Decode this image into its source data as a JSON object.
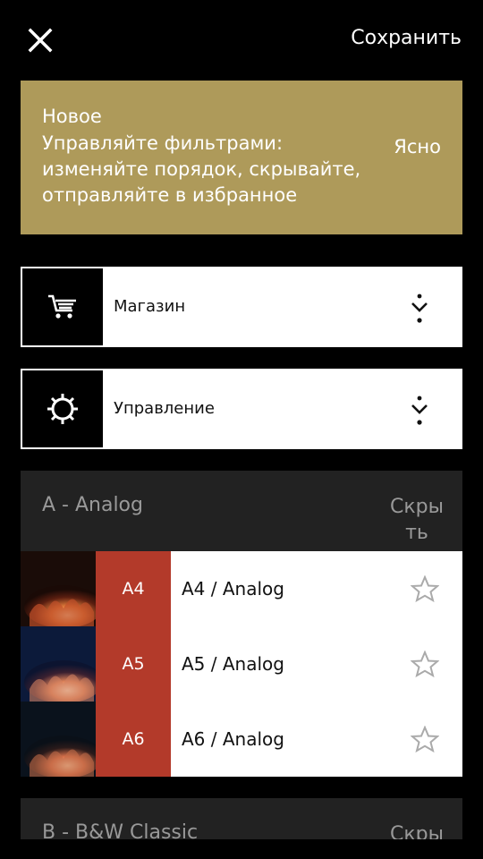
{
  "toolbar": {
    "close_icon": "close-icon",
    "save_label": "Сохранить"
  },
  "banner": {
    "title": "Новое",
    "text": "Управляйте фильтрами: изменяйте порядок, скрывайте, отправляйте в избранное",
    "ok_label": "Ясно",
    "background": "#ae9a5a"
  },
  "menu": [
    {
      "label": "Магазин",
      "icon": "shopping-cart-icon"
    },
    {
      "label": "Управление",
      "icon": "gear-icon"
    }
  ],
  "groups": [
    {
      "title": "A - Analog",
      "hide_label": "Скрыть",
      "filters": [
        {
          "code": "A4",
          "name": "A4 / Analog"
        },
        {
          "code": "A5",
          "name": "A5 / Analog"
        },
        {
          "code": "A6",
          "name": "A6 / Analog"
        }
      ]
    },
    {
      "title": "B - B&W Classic",
      "hide_label": "Скрыть"
    }
  ],
  "colors": {
    "accent_red": "#b33a2a",
    "group_bg": "#222222",
    "muted_text": "#999999"
  }
}
